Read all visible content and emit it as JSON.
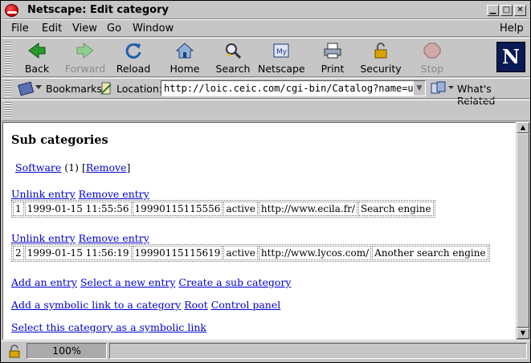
{
  "window": {
    "title": "Netscape: Edit category"
  },
  "menu": [
    "File",
    "Edit",
    "View",
    "Go",
    "Window",
    "Help"
  ],
  "toolbar": {
    "back": "Back",
    "forward": "Forward",
    "reload": "Reload",
    "home": "Home",
    "search": "Search",
    "netscape": "Netscape",
    "print": "Print",
    "security": "Security",
    "stop": "Stop",
    "logo": "N"
  },
  "location": {
    "bookmarks": "Bookmarks",
    "label": "Location:",
    "url": "http://loic.ceic.com/cgi-bin/Catalog?name=ur",
    "whats_related": "What's Related"
  },
  "content": {
    "heading": "Sub categories",
    "subcat": {
      "link": "Software",
      "count": "(1)",
      "bracket_open": "[",
      "remove": "Remove",
      "bracket_close": "]"
    },
    "entries": [
      {
        "unlink": "Unlink entry",
        "remove": "Remove entry",
        "cells": [
          "1",
          "1999-01-15 11:55:56",
          "19990115115556",
          "active",
          "http://www.ecila.fr/",
          "Search engine"
        ]
      },
      {
        "unlink": "Unlink entry",
        "remove": "Remove entry",
        "cells": [
          "2",
          "1999-01-15 11:56:19",
          "19990115115619",
          "active",
          "http://www.lycos.com/",
          "Another search engine"
        ]
      }
    ],
    "actions1": [
      "Add an entry",
      "Select a new entry",
      "Create a sub category"
    ],
    "actions2": [
      "Add a symbolic link to a category",
      "Root",
      "Control panel"
    ],
    "actions3": [
      "Select this category as a symbolic link"
    ]
  },
  "status": {
    "zoom": "100%"
  }
}
